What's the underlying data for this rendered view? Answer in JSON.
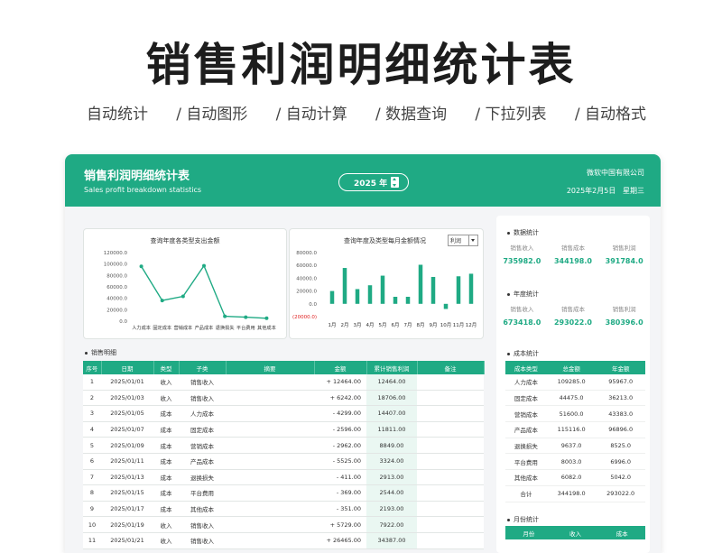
{
  "promo": {
    "title": "销售利润明细统计表",
    "features": [
      "自动统计",
      "/  自动图形",
      "/  自动计算",
      "/  数据查询",
      "/  下拉列表",
      "/  自动格式"
    ]
  },
  "header": {
    "title": "销售利润明细统计表",
    "subtitle": "Sales profit breakdown statistics",
    "year": "2025 年",
    "company": "微软中国有限公司",
    "date": "2025年2月5日",
    "weekday": "星期三"
  },
  "colors": {
    "accent": "#1faa84",
    "negative": "#e02020"
  },
  "chart_data": [
    {
      "type": "line",
      "title": "查询年度各类型支出金额",
      "categories": [
        "人力成本",
        "固定成本",
        "营销成本",
        "产品成本",
        "退换损失",
        "平台费用",
        "其他成本"
      ],
      "values": [
        95967.0,
        36213.0,
        43383.0,
        96896.0,
        8525.0,
        6996.0,
        5042.0
      ],
      "ylim": [
        0,
        120000
      ],
      "yticks": [
        "120000.0",
        "100000.0",
        "80000.0",
        "60000.0",
        "40000.0",
        "20000.0",
        "0.0"
      ],
      "grid": false
    },
    {
      "type": "bar",
      "title": "查询年度及类型每月金额情况",
      "selector": "利润",
      "categories": [
        "1月",
        "2月",
        "3月",
        "4月",
        "5月",
        "6月",
        "7月",
        "8月",
        "9月",
        "10月",
        "11月",
        "12月"
      ],
      "values": [
        20000,
        56000,
        23000,
        29000,
        44000,
        11000,
        11000,
        61000,
        42000,
        -8000,
        43000,
        47000
      ],
      "ylim": [
        -20000,
        80000
      ],
      "yticks": [
        "80000.0",
        "60000.0",
        "40000.0",
        "20000.0",
        "0.0",
        "(20000.0)"
      ],
      "grid": false
    }
  ],
  "detail": {
    "section_title": "销售明细",
    "columns": [
      "序号",
      "日期",
      "类型",
      "子类",
      "摘要",
      "金额",
      "累计销售利润",
      "备注"
    ],
    "rows": [
      [
        "1",
        "2025/01/01",
        "收入",
        "销售收入",
        "",
        "+ 12464.00",
        "12464.00",
        ""
      ],
      [
        "2",
        "2025/01/03",
        "收入",
        "销售收入",
        "",
        "+ 6242.00",
        "18706.00",
        ""
      ],
      [
        "3",
        "2025/01/05",
        "成本",
        "人力成本",
        "",
        "- 4299.00",
        "14407.00",
        ""
      ],
      [
        "4",
        "2025/01/07",
        "成本",
        "固定成本",
        "",
        "- 2596.00",
        "11811.00",
        ""
      ],
      [
        "5",
        "2025/01/09",
        "成本",
        "营销成本",
        "",
        "- 2962.00",
        "8849.00",
        ""
      ],
      [
        "6",
        "2025/01/11",
        "成本",
        "产品成本",
        "",
        "- 5525.00",
        "3324.00",
        ""
      ],
      [
        "7",
        "2025/01/13",
        "成本",
        "退换损失",
        "",
        "- 411.00",
        "2913.00",
        ""
      ],
      [
        "8",
        "2025/01/15",
        "成本",
        "平台费用",
        "",
        "- 369.00",
        "2544.00",
        ""
      ],
      [
        "9",
        "2025/01/17",
        "成本",
        "其他成本",
        "",
        "- 351.00",
        "2193.00",
        ""
      ],
      [
        "10",
        "2025/01/19",
        "收入",
        "销售收入",
        "",
        "+ 5729.00",
        "7922.00",
        ""
      ],
      [
        "11",
        "2025/01/21",
        "收入",
        "销售收入",
        "",
        "+ 26465.00",
        "34387.00",
        ""
      ]
    ]
  },
  "stats": {
    "data": {
      "title": "数据统计",
      "labels": [
        "销售收入",
        "销售成本",
        "销售利润"
      ],
      "values": [
        "735982.0",
        "344198.0",
        "391784.0"
      ]
    },
    "year": {
      "title": "年度统计",
      "labels": [
        "销售收入",
        "销售成本",
        "销售利润"
      ],
      "values": [
        "673418.0",
        "293022.0",
        "380396.0"
      ]
    }
  },
  "cost_stats": {
    "title": "成本统计",
    "columns": [
      "成本类型",
      "总金额",
      "年金额"
    ],
    "rows": [
      [
        "人力成本",
        "109285.0",
        "95967.0"
      ],
      [
        "固定成本",
        "44475.0",
        "36213.0"
      ],
      [
        "营销成本",
        "51600.0",
        "43383.0"
      ],
      [
        "产品成本",
        "115116.0",
        "96896.0"
      ],
      [
        "退换损失",
        "9637.0",
        "8525.0"
      ],
      [
        "平台费用",
        "8003.0",
        "6996.0"
      ],
      [
        "其他成本",
        "6082.0",
        "5042.0"
      ],
      [
        "合计",
        "344198.0",
        "293022.0"
      ]
    ]
  },
  "month_stats": {
    "title": "月份统计",
    "columns": [
      "月份",
      "收入",
      "成本"
    ]
  }
}
